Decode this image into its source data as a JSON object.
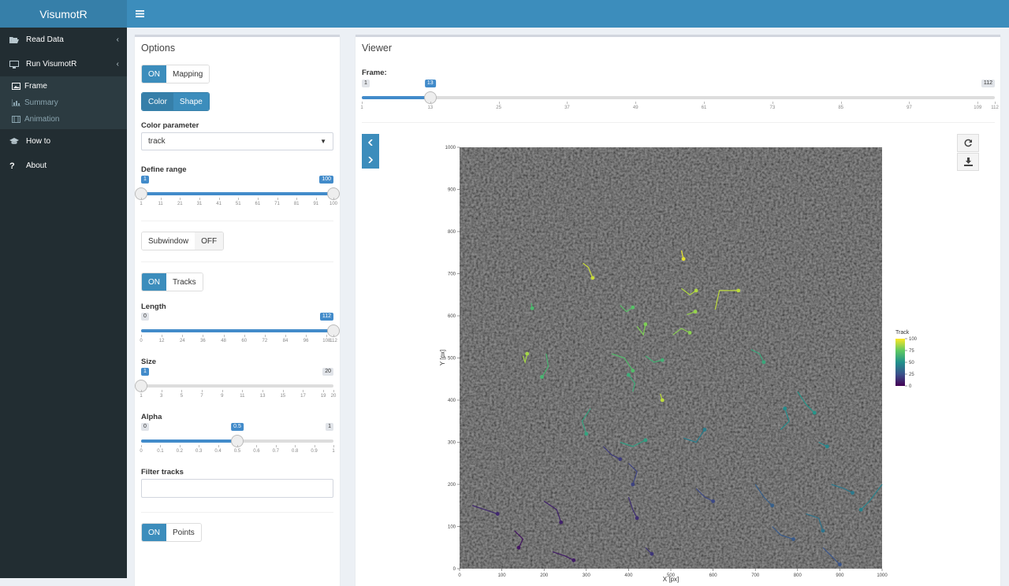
{
  "header": {
    "logo": "VisumotR"
  },
  "sidebar": {
    "items": [
      {
        "label": "Read Data",
        "icon": "folder-open-icon"
      },
      {
        "label": "Run VisumotR",
        "icon": "desktop-icon"
      }
    ],
    "subitems": [
      {
        "label": "Frame",
        "icon": "image-icon",
        "active": true
      },
      {
        "label": "Summary",
        "icon": "bar-chart-icon"
      },
      {
        "label": "Animation",
        "icon": "film-icon"
      }
    ],
    "bottom": [
      {
        "label": "How to",
        "icon": "graduation-cap-icon"
      },
      {
        "label": "About",
        "icon": "question-icon"
      }
    ]
  },
  "options": {
    "title": "Options",
    "mapping": {
      "on": "ON",
      "label": "Mapping"
    },
    "colorshape": {
      "color": "Color",
      "shape": "Shape"
    },
    "color_param": {
      "label": "Color parameter",
      "value": "track"
    },
    "define_range": {
      "label": "Define range",
      "min": "1",
      "max": "100",
      "value": "100",
      "from": "1",
      "ticks": [
        "1",
        "11",
        "21",
        "31",
        "41",
        "51",
        "61",
        "71",
        "81",
        "91",
        "100"
      ]
    },
    "subwindow": {
      "label": "Subwindow",
      "off": "OFF"
    },
    "tracks": {
      "on": "ON",
      "label": "Tracks"
    },
    "length": {
      "label": "Length",
      "min": "0",
      "max": "112",
      "value": "112",
      "ticks": [
        "0",
        "12",
        "24",
        "36",
        "48",
        "60",
        "72",
        "84",
        "96",
        "108",
        "112"
      ]
    },
    "size": {
      "label": "Size",
      "min": "1",
      "max": "20",
      "value": "1",
      "ticks": [
        "1",
        "3",
        "5",
        "7",
        "9",
        "11",
        "13",
        "15",
        "17",
        "19",
        "20"
      ]
    },
    "alpha": {
      "label": "Alpha",
      "min": "0",
      "max": "1",
      "value": "0.5",
      "ticks": [
        "0",
        "0.1",
        "0.2",
        "0.3",
        "0.4",
        "0.5",
        "0.6",
        "0.7",
        "0.8",
        "0.9",
        "1"
      ]
    },
    "filter": {
      "label": "Filter tracks",
      "value": ""
    },
    "points": {
      "on": "ON",
      "label": "Points"
    }
  },
  "viewer": {
    "title": "Viewer",
    "frame": {
      "label": "Frame:",
      "min": "1",
      "max": "112",
      "value": "13",
      "ticks": [
        "1",
        "13",
        "25",
        "37",
        "49",
        "61",
        "73",
        "85",
        "97",
        "109",
        "112"
      ]
    }
  },
  "chart_data": {
    "type": "scatter",
    "xlabel": "X [px]",
    "ylabel": "Y [px]",
    "xlim": [
      0,
      1000
    ],
    "ylim": [
      0,
      1000
    ],
    "xticks": [
      "0",
      "100",
      "200",
      "300",
      "400",
      "500",
      "600",
      "700",
      "800",
      "900",
      "1000"
    ],
    "yticks": [
      "0",
      "100",
      "200",
      "300",
      "400",
      "500",
      "600",
      "700",
      "800",
      "900",
      "1000"
    ],
    "legend": {
      "title": "Track",
      "ticks": [
        "100",
        "75",
        "50",
        "25",
        "0"
      ],
      "colors": [
        "#fde725",
        "#5ec962",
        "#21918c",
        "#3b528b",
        "#440154"
      ],
      "placement": "right"
    },
    "background": "#1a1a1a",
    "series": [
      {
        "track": 92,
        "points": [
          [
            292,
            725
          ],
          [
            305,
            715
          ],
          [
            315,
            690
          ]
        ]
      },
      {
        "track": 96,
        "points": [
          [
            525,
            755
          ],
          [
            530,
            735
          ]
        ]
      },
      {
        "track": 88,
        "points": [
          [
            525,
            665
          ],
          [
            545,
            650
          ],
          [
            560,
            660
          ]
        ]
      },
      {
        "track": 90,
        "points": [
          [
            605,
            615
          ],
          [
            615,
            660
          ],
          [
            660,
            660
          ]
        ]
      },
      {
        "track": 84,
        "points": [
          [
            538,
            603
          ],
          [
            558,
            610
          ]
        ]
      },
      {
        "track": 82,
        "points": [
          [
            505,
            555
          ],
          [
            525,
            570
          ],
          [
            545,
            560
          ]
        ]
      },
      {
        "track": 80,
        "points": [
          [
            420,
            575
          ],
          [
            435,
            555
          ],
          [
            440,
            580
          ]
        ]
      },
      {
        "track": 72,
        "points": [
          [
            380,
            625
          ],
          [
            395,
            610
          ],
          [
            410,
            620
          ]
        ]
      },
      {
        "track": 68,
        "points": [
          [
            170,
            630
          ],
          [
            172,
            618
          ]
        ]
      },
      {
        "track": 86,
        "points": [
          [
            150,
            505
          ],
          [
            155,
            490
          ],
          [
            160,
            510
          ]
        ]
      },
      {
        "track": 66,
        "points": [
          [
            205,
            510
          ],
          [
            210,
            480
          ],
          [
            195,
            455
          ]
        ]
      },
      {
        "track": 70,
        "points": [
          [
            360,
            510
          ],
          [
            390,
            500
          ],
          [
            410,
            470
          ]
        ]
      },
      {
        "track": 64,
        "points": [
          [
            440,
            505
          ],
          [
            460,
            490
          ],
          [
            480,
            495
          ]
        ]
      },
      {
        "track": 90,
        "points": [
          [
            475,
            415
          ],
          [
            480,
            400
          ]
        ]
      },
      {
        "track": 62,
        "points": [
          [
            410,
            420
          ],
          [
            415,
            440
          ],
          [
            400,
            460
          ]
        ]
      },
      {
        "track": 58,
        "points": [
          [
            310,
            380
          ],
          [
            290,
            350
          ],
          [
            300,
            320
          ]
        ]
      },
      {
        "track": 56,
        "points": [
          [
            380,
            300
          ],
          [
            410,
            290
          ],
          [
            440,
            305
          ]
        ]
      },
      {
        "track": 60,
        "points": [
          [
            690,
            520
          ],
          [
            710,
            510
          ],
          [
            720,
            490
          ]
        ]
      },
      {
        "track": 52,
        "points": [
          [
            800,
            420
          ],
          [
            820,
            390
          ],
          [
            840,
            370
          ]
        ]
      },
      {
        "track": 48,
        "points": [
          [
            760,
            330
          ],
          [
            780,
            350
          ],
          [
            770,
            380
          ]
        ]
      },
      {
        "track": 46,
        "points": [
          [
            850,
            300
          ],
          [
            870,
            290
          ]
        ]
      },
      {
        "track": 42,
        "points": [
          [
            530,
            310
          ],
          [
            560,
            300
          ],
          [
            580,
            330
          ]
        ]
      },
      {
        "track": 40,
        "points": [
          [
            880,
            200
          ],
          [
            910,
            190
          ],
          [
            930,
            180
          ]
        ]
      },
      {
        "track": 44,
        "points": [
          [
            1000,
            200
          ],
          [
            970,
            160
          ],
          [
            950,
            140
          ]
        ]
      },
      {
        "track": 38,
        "points": [
          [
            820,
            130
          ],
          [
            850,
            120
          ],
          [
            860,
            90
          ]
        ]
      },
      {
        "track": 30,
        "points": [
          [
            700,
            200
          ],
          [
            720,
            170
          ],
          [
            740,
            150
          ]
        ]
      },
      {
        "track": 28,
        "points": [
          [
            740,
            100
          ],
          [
            760,
            80
          ],
          [
            790,
            70
          ]
        ]
      },
      {
        "track": 26,
        "points": [
          [
            860,
            50
          ],
          [
            880,
            30
          ],
          [
            900,
            10
          ]
        ]
      },
      {
        "track": 22,
        "points": [
          [
            560,
            190
          ],
          [
            580,
            170
          ],
          [
            600,
            160
          ]
        ]
      },
      {
        "track": 20,
        "points": [
          [
            400,
            250
          ],
          [
            420,
            230
          ],
          [
            410,
            200
          ]
        ]
      },
      {
        "track": 18,
        "points": [
          [
            340,
            290
          ],
          [
            360,
            270
          ],
          [
            380,
            260
          ]
        ]
      },
      {
        "track": 12,
        "points": [
          [
            30,
            150
          ],
          [
            60,
            140
          ],
          [
            90,
            130
          ]
        ]
      },
      {
        "track": 10,
        "points": [
          [
            200,
            160
          ],
          [
            230,
            140
          ],
          [
            240,
            110
          ]
        ]
      },
      {
        "track": 8,
        "points": [
          [
            220,
            40
          ],
          [
            250,
            30
          ],
          [
            270,
            20
          ]
        ]
      },
      {
        "track": 14,
        "points": [
          [
            400,
            170
          ],
          [
            410,
            140
          ],
          [
            420,
            120
          ]
        ]
      },
      {
        "track": 16,
        "points": [
          [
            440,
            50
          ],
          [
            455,
            35
          ]
        ]
      },
      {
        "track": 6,
        "points": [
          [
            130,
            90
          ],
          [
            150,
            70
          ],
          [
            140,
            50
          ]
        ]
      }
    ]
  }
}
